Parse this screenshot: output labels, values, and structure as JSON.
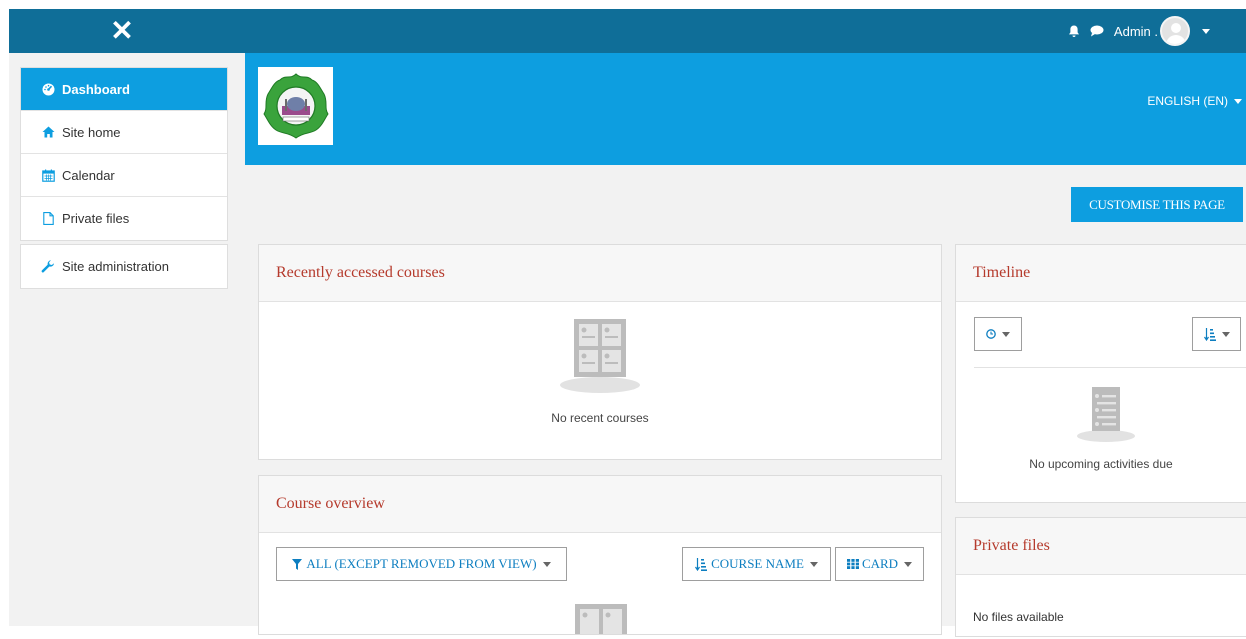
{
  "topbar": {
    "close_glyph": "✕",
    "user_name": "Admin .",
    "icons": [
      "bell-icon",
      "chat-icon",
      "avatar",
      "chevron-down-icon"
    ]
  },
  "sidebar": {
    "items": [
      {
        "label": "Dashboard",
        "icon": "dashboard-icon",
        "active": true
      },
      {
        "label": "Site home",
        "icon": "home-icon"
      },
      {
        "label": "Calendar",
        "icon": "calendar-icon"
      },
      {
        "label": "Private files",
        "icon": "file-icon"
      }
    ],
    "admin": {
      "label": "Site administration",
      "icon": "wrench-icon"
    }
  },
  "header": {
    "language": "ENGLISH (EN)",
    "customise_label": "CUSTOMISE THIS PAGE"
  },
  "recent": {
    "title": "Recently accessed courses",
    "empty": "No recent courses"
  },
  "overview": {
    "title": "Course overview",
    "filter_label": "ALL (EXCEPT REMOVED FROM VIEW)",
    "sort_label": "COURSE NAME",
    "view_label": "CARD"
  },
  "timeline": {
    "title": "Timeline",
    "empty": "No upcoming activities due"
  },
  "private_files": {
    "title": "Private files",
    "empty": "No files available"
  },
  "colors": {
    "topbar": "#0f6e98",
    "accent": "#0d9ee0",
    "card_title": "#b53a2c"
  }
}
